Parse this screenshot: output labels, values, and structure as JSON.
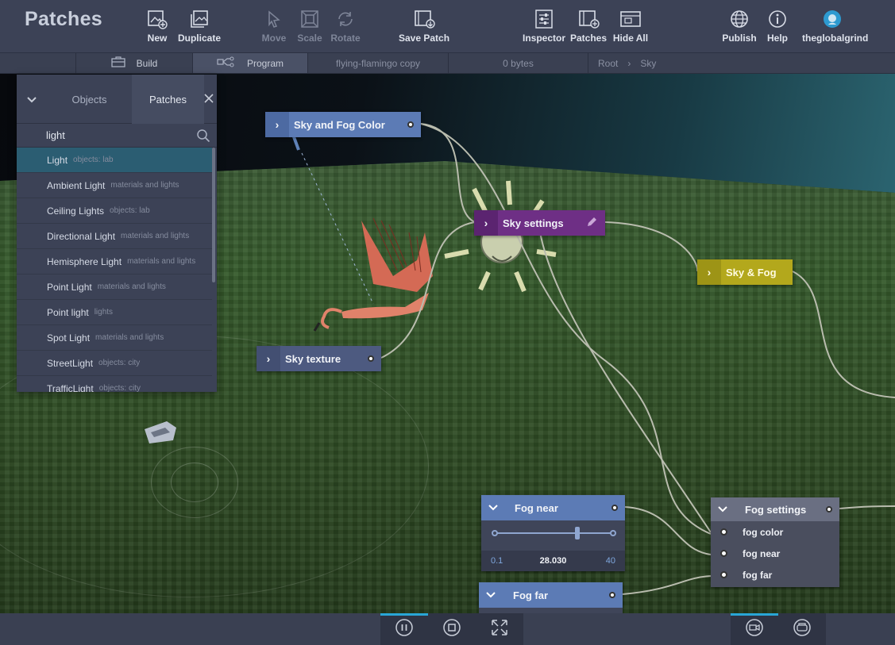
{
  "app": {
    "title": "Patches"
  },
  "toolbar": {
    "new": "New",
    "duplicate": "Duplicate",
    "move": "Move",
    "scale": "Scale",
    "rotate": "Rotate",
    "save_patch": "Save Patch",
    "inspector": "Inspector",
    "patches": "Patches",
    "hide_all": "Hide All",
    "publish": "Publish",
    "help": "Help",
    "user": "theglobalgrind"
  },
  "tabbar": {
    "build": "Build",
    "program": "Program",
    "file": "flying-flamingo copy",
    "size": "0 bytes",
    "breadcrumb_root": "Root",
    "breadcrumb_sep": "›",
    "breadcrumb_current": "Sky"
  },
  "panel": {
    "tab_objects": "Objects",
    "tab_patches": "Patches",
    "search_value": "light",
    "items": [
      {
        "name": "Light",
        "category": "objects: lab"
      },
      {
        "name": "Ambient Light",
        "category": "materials and lights"
      },
      {
        "name": "Ceiling Lights",
        "category": "objects: lab"
      },
      {
        "name": "Directional Light",
        "category": "materials and lights"
      },
      {
        "name": "Hemisphere Light",
        "category": "materials and lights"
      },
      {
        "name": "Point Light",
        "category": "materials and lights"
      },
      {
        "name": "Point light",
        "category": "lights"
      },
      {
        "name": "Spot Light",
        "category": "materials and lights"
      },
      {
        "name": "StreetLight",
        "category": "objects: city"
      },
      {
        "name": "TrafficLight",
        "category": "objects: city"
      }
    ]
  },
  "nodes": {
    "sky_fog_color": "Sky and Fog Color",
    "sky_settings": "Sky settings",
    "sky_and_fog": "Sky & Fog",
    "sky_texture": "Sky texture",
    "fog_near": {
      "title": "Fog near",
      "min": "0.1",
      "value": "28.030",
      "max": "40",
      "fraction": 0.7
    },
    "fog_far": "Fog far",
    "fog_settings": {
      "title": "Fog settings",
      "inputs": [
        "fog color",
        "fog near",
        "fog far"
      ]
    }
  },
  "colors": {
    "accent": "#29a6d6",
    "node_blue": "#5c7bb5",
    "node_purple": "#6e2f85",
    "node_yellow": "#b3a81c"
  }
}
